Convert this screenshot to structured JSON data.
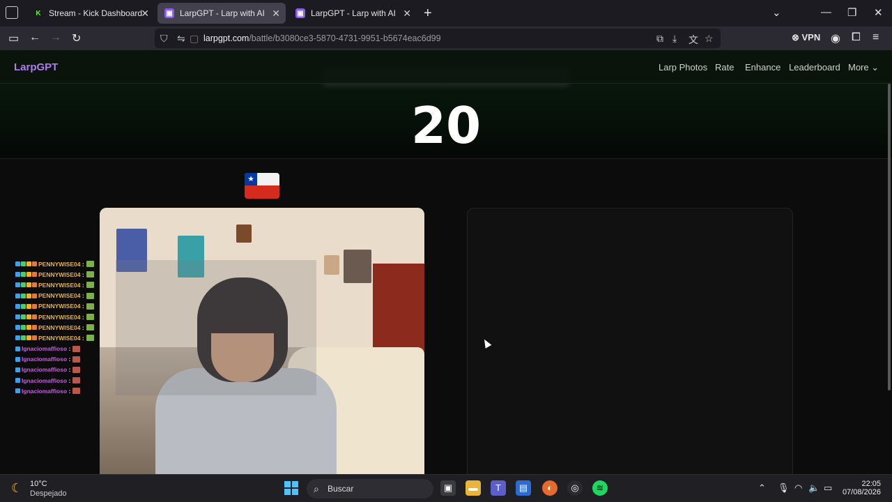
{
  "browser": {
    "tabs": [
      {
        "title": "Stream - Kick Dashboard",
        "favicon": "kick-icon",
        "active": false
      },
      {
        "title": "LarpGPT - Larp with AI",
        "favicon": "larpgpt-icon",
        "active": true
      },
      {
        "title": "LarpGPT - Larp with AI",
        "favicon": "larpgpt-icon",
        "active": false
      }
    ],
    "url_host": "larpgpt.com",
    "url_path": "/battle/b3080ce3-5870-4731-9951-b5674eac6d99",
    "vpn_label": "VPN"
  },
  "site": {
    "logo": "LarpGPT",
    "nav": [
      "Larp Photos",
      "Rate",
      "Enhance",
      "Leaderboard",
      "More"
    ],
    "score": "20",
    "flag": "chile-flag"
  },
  "chat": {
    "lines": [
      {
        "user": "PENNYWISE04",
        "color": "#f2b224"
      },
      {
        "user": "PENNYWISE04",
        "color": "#f2b224"
      },
      {
        "user": "PENNYWISE04",
        "color": "#f2b224"
      },
      {
        "user": "PENNYWISE04",
        "color": "#f2b224"
      },
      {
        "user": "PENNYWISE04",
        "color": "#f2b224"
      },
      {
        "user": "PENNYWISE04",
        "color": "#f2b224"
      },
      {
        "user": "PENNYWISE04",
        "color": "#f2b224"
      },
      {
        "user": "PENNYWISE04",
        "color": "#f2b224"
      },
      {
        "user": "Ignaciomaffioso",
        "color": "#c65ce0"
      },
      {
        "user": "Ignaciomaffioso",
        "color": "#c65ce0"
      },
      {
        "user": "Ignaciomaffioso",
        "color": "#c65ce0"
      },
      {
        "user": "Ignaciomaffioso",
        "color": "#c65ce0"
      },
      {
        "user": "Ignaciomaffioso",
        "color": "#c65ce0"
      }
    ],
    "separator": ":"
  },
  "taskbar": {
    "weather_temp": "10°C",
    "weather_desc": "Despejado",
    "search_label": "Buscar",
    "time": "22:05",
    "date": "07/08/2026"
  }
}
